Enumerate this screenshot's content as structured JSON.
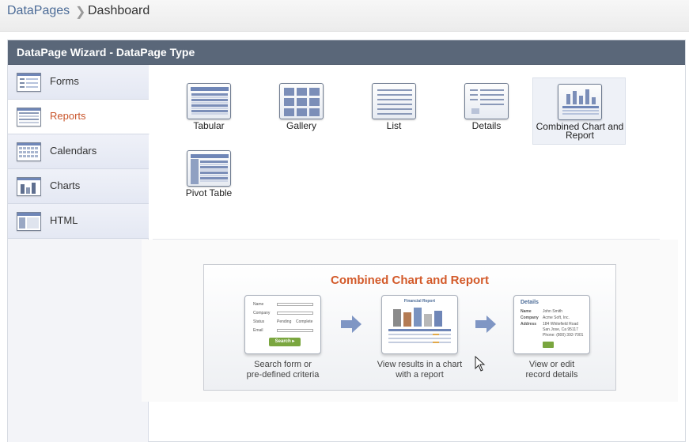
{
  "breadcrumb": {
    "root": "DataPages",
    "separator": "❯",
    "current": "Dashboard"
  },
  "wizard": {
    "title": "DataPage Wizard - DataPage Type"
  },
  "sidebar": {
    "items": [
      {
        "label": "Forms",
        "icon": "forms-icon",
        "active": false
      },
      {
        "label": "Reports",
        "icon": "reports-icon",
        "active": true
      },
      {
        "label": "Calendars",
        "icon": "calendars-icon",
        "active": false
      },
      {
        "label": "Charts",
        "icon": "charts-icon",
        "active": false
      },
      {
        "label": "HTML",
        "icon": "html-icon",
        "active": false
      }
    ]
  },
  "types": [
    {
      "label": "Tabular",
      "icon": "tabular-icon",
      "selected": false
    },
    {
      "label": "Gallery",
      "icon": "gallery-icon",
      "selected": false
    },
    {
      "label": "List",
      "icon": "list-icon",
      "selected": false
    },
    {
      "label": "Details",
      "icon": "details-icon",
      "selected": false
    },
    {
      "label": "Combined Chart and Report",
      "icon": "combined-chart-report-icon",
      "selected": true
    },
    {
      "label": "Pivot Table",
      "icon": "pivot-table-icon",
      "selected": false
    }
  ],
  "preview": {
    "title": "Combined Chart and Report",
    "search_card": {
      "fields": [
        "Name",
        "Company",
        "Status",
        "Email"
      ],
      "status_options": [
        "Pending",
        "Complete"
      ],
      "button": "Search ▸"
    },
    "results_card": {
      "heading": "Financial Report"
    },
    "details_card": {
      "heading": "Details",
      "fields": [
        {
          "label": "Name",
          "value": "John Smith"
        },
        {
          "label": "Company",
          "value": "Acme Soft, Inc."
        },
        {
          "label": "Address",
          "value": "184 Whitefield Road"
        }
      ],
      "extra_lines": [
        "San Jose, Ca 95117",
        "Phone: (800) 392-7001"
      ]
    },
    "steps": [
      {
        "caption_line1": "Search form or",
        "caption_line2": "pre-defined criteria"
      },
      {
        "caption_line1": "View results in a chart",
        "caption_line2": "with a report"
      },
      {
        "caption_line1": "View or edit",
        "caption_line2": "record details"
      }
    ]
  },
  "colors": {
    "header_bg": "#5a6779",
    "active_label": "#c8542a",
    "preview_title": "#d35a2a",
    "link": "#4b6b97",
    "search_button": "#7aa63f"
  }
}
